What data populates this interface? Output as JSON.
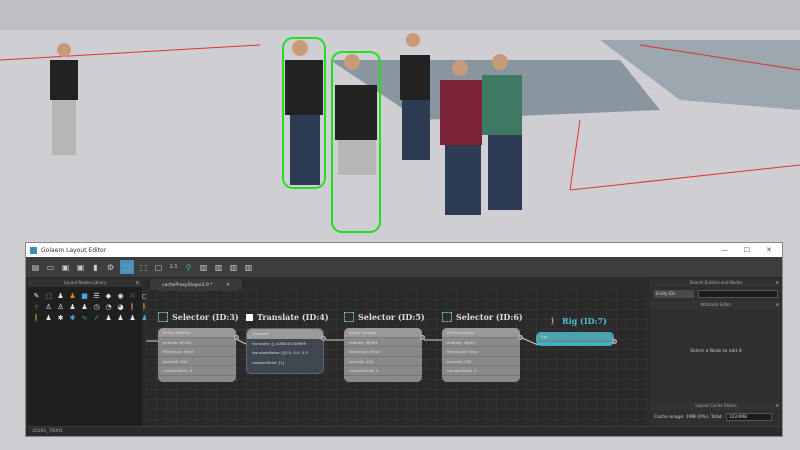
{
  "window": {
    "title": "Golaem Layout Editor",
    "minimize": "—",
    "maximize": "☐",
    "close": "✕"
  },
  "toolbar": {
    "zoom_label": "1:1"
  },
  "left_panel": {
    "title": "Layout Nodes Library"
  },
  "tab": {
    "label": "cacheProxyShape1 0 *",
    "close": "✕"
  },
  "nodes": [
    {
      "title": "Selector (ID:3)",
      "rows": [
        "Entity Selector",
        "entities: 67001",
        "filterInput: False",
        "percent: 100",
        "randomSeed: 0"
      ]
    },
    {
      "title": "Translate (ID:4)",
      "rows": [
        "Translate",
        "translate: [[-4.88445746999",
        "translateNoise: [[0.0, 0.0, 0.0",
        "randomSeed: [1]"
      ]
    },
    {
      "title": "Selector (ID:5)",
      "rows": [
        "Entity Selector",
        "entities: 39001",
        "filterInput: False",
        "percent: 100",
        "randomSeed: 0"
      ]
    },
    {
      "title": "Selector (ID:6)",
      "rows": [
        "Entity Selector",
        "entities: 39001",
        "filterInput: False",
        "percent: 100",
        "randomSeed: 0"
      ]
    },
    {
      "title": "Rig (ID:7)",
      "rows": [
        "Rig"
      ]
    }
  ],
  "right_panel": {
    "search_title": "Search Entities and Nodes",
    "search_type": "Entity IDs",
    "search_value": "",
    "attr_title": "Attribute Editor",
    "attr_hint": "Select a Node to edit it",
    "cache_title": "Layout Cache Status",
    "cache_usage": "Cache usage: 1MB (0%). Total:",
    "cache_total": "1024MB"
  },
  "status": "35001_70001",
  "colors": {
    "accent": "#4a90b8",
    "rig": "#3fb2c0",
    "selection": "#22dd22"
  }
}
